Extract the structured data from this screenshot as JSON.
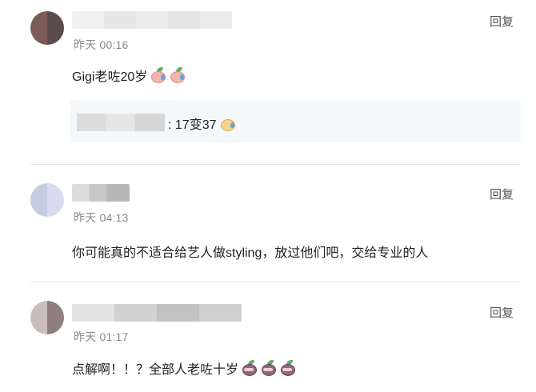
{
  "comments": [
    {
      "time": "昨天 00:16",
      "reply_label": "回复",
      "text": "Gigi老咗20岁",
      "quote": {
        "text": ": 17变37"
      }
    },
    {
      "time": "昨天 04:13",
      "reply_label": "回复",
      "text": "你可能真的不适合给艺人做styling，放过他们吧，交给专业的人"
    },
    {
      "time": "昨天 01:17",
      "reply_label": "回复",
      "text": "点解啊！！？全部人老咗十岁"
    }
  ],
  "emoji_icons": {
    "c1": [
      "crying-pig-emoji-icon",
      "crying-pig-emoji-icon"
    ],
    "c1_quote": [
      "crying-face-emoji-icon"
    ],
    "c3": [
      "dark-pig-emoji-icon",
      "dark-pig-emoji-icon",
      "dark-pig-emoji-icon"
    ]
  }
}
